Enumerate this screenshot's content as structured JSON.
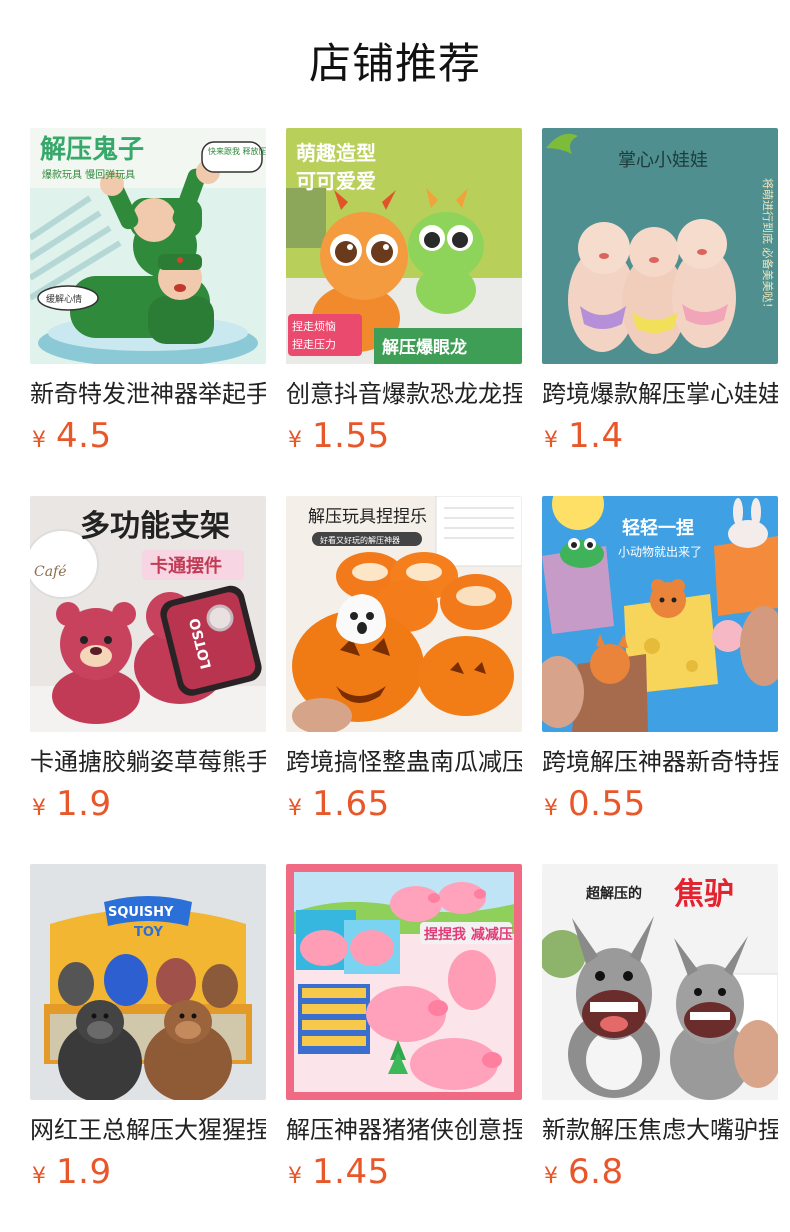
{
  "header": {
    "title": "店铺推荐"
  },
  "products": [
    {
      "name": "新奇特发泄神器举起手来解压玩具",
      "currency": "¥",
      "price": "4.5",
      "image_icon": "soldier-squishy-toy-image",
      "image_text": [
        "解压鬼子",
        "爆款玩具 慢回弹玩具",
        "快来跟我 释放压力",
        "缓解心情"
      ],
      "colors": {
        "bg": "#dff2ec",
        "accent": "#2f8a3c"
      }
    },
    {
      "name": "创意抖音爆款恐龙龙捏捏乐",
      "currency": "¥",
      "price": "1.55",
      "image_icon": "big-eye-dragon-toy-image",
      "image_text": [
        "萌趣造型",
        "可可爱爱",
        "捏走烦恼",
        "捏走压力",
        "解压爆眼龙"
      ],
      "colors": {
        "bg": "#b8cf5a",
        "accent": "#f08a2c"
      }
    },
    {
      "name": "跨境爆款解压掌心娃娃减压玩具",
      "currency": "¥",
      "price": "1.4",
      "image_icon": "palm-baby-doll-image",
      "image_text": [
        "掌心小娃娃",
        "将萌进行到底 必备美美哒！"
      ],
      "colors": {
        "bg": "#4f8f8f",
        "accent": "#f3d3c4"
      }
    },
    {
      "name": "卡通搪胶躺姿草莓熊手机支架",
      "currency": "¥",
      "price": "1.9",
      "image_icon": "strawberry-bear-phone-stand-image",
      "image_text": [
        "多功能支架",
        "卡通摆件",
        "Café",
        "LOTSO"
      ],
      "colors": {
        "bg": "#e9e6e3",
        "accent": "#c23b56"
      }
    },
    {
      "name": "跨境搞怪整蛊南瓜减压玩具",
      "currency": "¥",
      "price": "1.65",
      "image_icon": "pumpkin-ghost-squeeze-image",
      "image_text": [
        "解压玩具捏捏乐",
        "好看又好玩的解压神器"
      ],
      "colors": {
        "bg": "#f4efe8",
        "accent": "#f07a14"
      }
    },
    {
      "name": "跨境解压神器新奇特捏捏乐",
      "currency": "¥",
      "price": "0.55",
      "image_icon": "cheese-animal-squeeze-image",
      "image_text": [
        "轻轻一捏",
        "小动物就出来了"
      ],
      "colors": {
        "bg": "#3fa0e4",
        "accent": "#f5c73a"
      }
    },
    {
      "name": "网红王总解压大猩猩捏捏乐",
      "currency": "¥",
      "price": "1.9",
      "image_icon": "gorilla-squishy-toy-image",
      "image_text": [
        "SQUISHY",
        "TOY"
      ],
      "colors": {
        "bg": "#dfe3e6",
        "accent": "#f2b632"
      }
    },
    {
      "name": "解压神器猪猪侠创意捏捏乐",
      "currency": "¥",
      "price": "1.45",
      "image_icon": "pink-pig-squeeze-image",
      "image_text": [
        "捏捏我 减减压"
      ],
      "colors": {
        "bg": "#f06a83",
        "accent": "#ffb6c8"
      }
    },
    {
      "name": "新款解压焦虑大嘴驴捏捏乐",
      "currency": "¥",
      "price": "6.8",
      "image_icon": "big-mouth-donkey-toy-image",
      "image_text": [
        "超解压的",
        "焦驴"
      ],
      "colors": {
        "bg": "#f3f3f3",
        "accent": "#e3232f"
      }
    }
  ]
}
